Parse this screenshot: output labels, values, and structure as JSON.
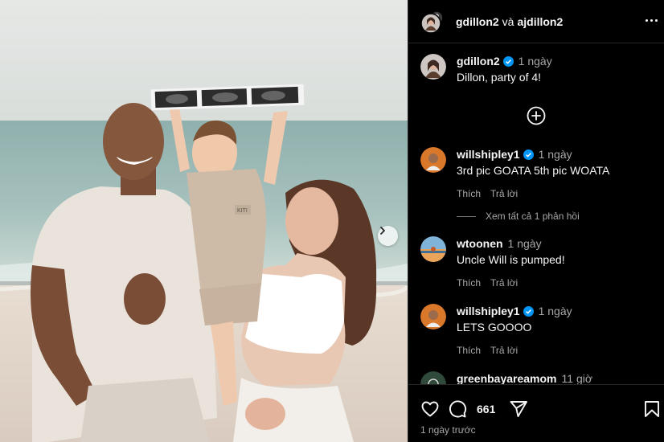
{
  "header": {
    "user1": "gdillon2",
    "connector": "và",
    "user2": "ajdillon2"
  },
  "caption": {
    "username": "gdillon2",
    "time": "1 ngày",
    "text": "Dillon, party of 4!"
  },
  "comments": [
    {
      "username": "willshipley1",
      "verified": true,
      "time": "1 ngày",
      "text": "3rd pic GOATA 5th pic WOATA",
      "like_label": "Thích",
      "reply_label": "Trả lời"
    },
    {
      "username": "wtoonen",
      "verified": false,
      "time": "1 ngày",
      "text": "Uncle Will is pumped!",
      "like_label": "Thích",
      "reply_label": "Trả lời"
    },
    {
      "username": "willshipley1",
      "verified": true,
      "time": "1 ngày",
      "text": "LETS GOOOO",
      "like_label": "Thích",
      "reply_label": "Trả lời"
    },
    {
      "username": "greenbayareamom",
      "verified": false,
      "time": "11 giờ",
      "text": ""
    }
  ],
  "view_replies": "Xem tất cả 1 phản hồi",
  "footer": {
    "comment_count": "661",
    "date": "1 ngày trước"
  },
  "photo": {
    "card_label": "KITI"
  },
  "icons": {
    "options": "more-options-icon",
    "add_comment": "plus-circle-icon",
    "like": "heart-icon",
    "comment": "comment-icon",
    "share": "paper-plane-icon",
    "save": "bookmark-icon",
    "next": "chevron-right-icon",
    "verified": "verified-badge-icon"
  },
  "colors": {
    "background": "#000000",
    "verified_blue": "#0095f6",
    "text_secondary": "#a8a8a8",
    "divider": "#262626"
  }
}
